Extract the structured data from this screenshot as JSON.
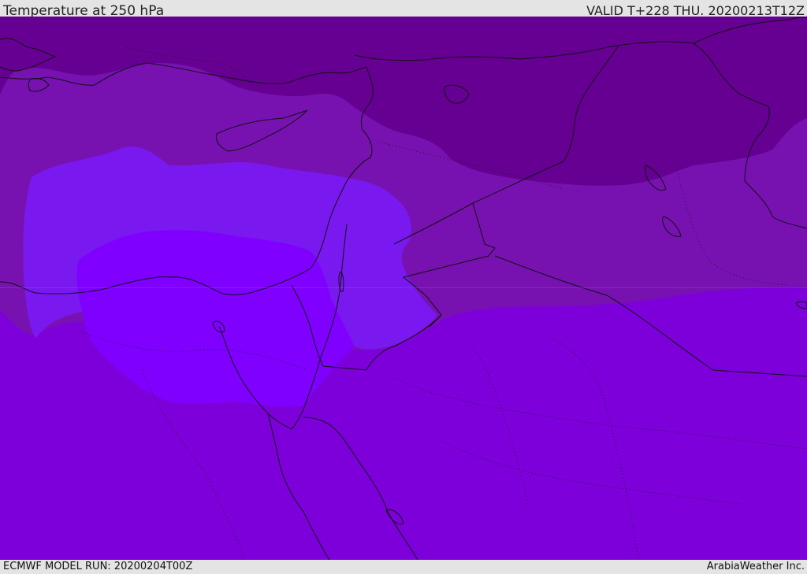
{
  "header": {
    "title": "Temperature at 250 hPa",
    "valid": "VALID T+228 THU. 20200213T12Z"
  },
  "footer": {
    "model_run": "ECMWF MODEL RUN: 20200204T00Z",
    "credit": "ArabiaWeather Inc."
  },
  "palette": {
    "darkest": "#660092",
    "dark": "#7712b0",
    "mid": "#7d00db",
    "light": "#7a18f0",
    "lightest": "#7f00ff",
    "coast": "#111111",
    "bar_bg": "#e4e4e4"
  }
}
